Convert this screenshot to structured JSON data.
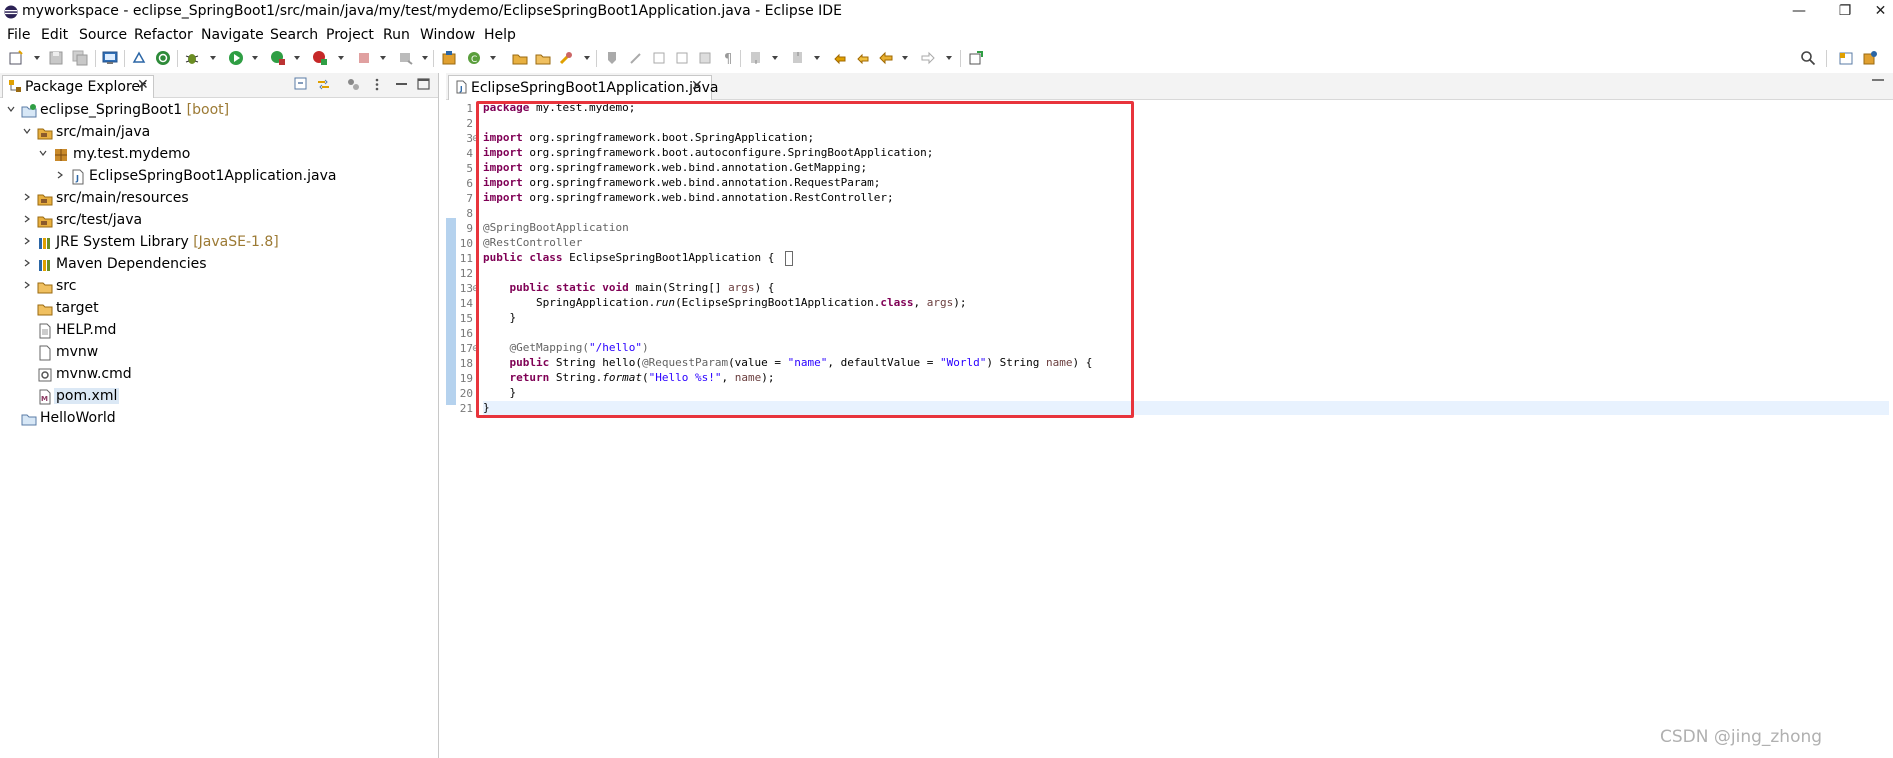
{
  "window": {
    "title": "myworkspace - eclipse_SpringBoot1/src/main/java/my/test/mydemo/EclipseSpringBoot1Application.java - Eclipse IDE",
    "minimize": "—",
    "restore": "❐",
    "close": "✕"
  },
  "menu": [
    "File",
    "Edit",
    "Source",
    "Refactor",
    "Navigate",
    "Search",
    "Project",
    "Run",
    "Window",
    "Help"
  ],
  "package_explorer": {
    "tab_label": "Package Explorer",
    "close": "✕",
    "tree": [
      {
        "label": "eclipse_SpringBoot1",
        "decor": " [boot]",
        "icon": "project-icon"
      },
      {
        "label": "src/main/java",
        "decor": "",
        "icon": "source-folder-icon"
      },
      {
        "label": "my.test.mydemo",
        "decor": "",
        "icon": "package-icon"
      },
      {
        "label": "EclipseSpringBoot1Application.java",
        "decor": "",
        "icon": "java-file-icon"
      },
      {
        "label": "src/main/resources",
        "decor": "",
        "icon": "source-folder-icon"
      },
      {
        "label": "src/test/java",
        "decor": "",
        "icon": "source-folder-icon"
      },
      {
        "label": "JRE System Library",
        "decor": " [JavaSE-1.8]",
        "icon": "library-icon"
      },
      {
        "label": "Maven Dependencies",
        "decor": "",
        "icon": "library-icon"
      },
      {
        "label": "src",
        "decor": "",
        "icon": "folder-icon"
      },
      {
        "label": "target",
        "decor": "",
        "icon": "folder-icon"
      },
      {
        "label": "HELP.md",
        "decor": "",
        "icon": "text-file-icon"
      },
      {
        "label": "mvnw",
        "decor": "",
        "icon": "text-file-icon"
      },
      {
        "label": "mvnw.cmd",
        "decor": "",
        "icon": "cmd-file-icon"
      },
      {
        "label": "pom.xml",
        "decor": "",
        "icon": "xml-file-icon"
      },
      {
        "label": "HelloWorld",
        "decor": "",
        "icon": "project-icon"
      }
    ]
  },
  "editor": {
    "tab_label": "EclipseSpringBoot1Application.java",
    "close": "✕",
    "line_numbers": [
      "1",
      "2",
      "3",
      "4",
      "5",
      "6",
      "7",
      "8",
      "9",
      "10",
      "11",
      "12",
      "13",
      "14",
      "15",
      "16",
      "17",
      "18",
      "19",
      "20",
      "21"
    ],
    "fold_markers": [
      "⊖",
      "⊖",
      "⊖"
    ],
    "code": {
      "l1_kw": "package",
      "l1_rest": " my.test.mydemo;",
      "import_kw": "import",
      "l3_rest": " org.springframework.boot.SpringApplication;",
      "l4_rest": " org.springframework.boot.autoconfigure.SpringBootApplication;",
      "l5_rest": " org.springframework.web.bind.annotation.GetMapping;",
      "l6_rest": " org.springframework.web.bind.annotation.RequestParam;",
      "l7_rest": " org.springframework.web.bind.annotation.RestController;",
      "l9": "@SpringBootApplication",
      "l10": "@RestController",
      "l11_kw": "public class",
      "l11_rest": " EclipseSpringBoot1Application ",
      "l11_brace": "{",
      "l13_indent": "    ",
      "l13_kw": "public static void",
      "l13_rest": " main(String[] ",
      "l13_var": "args",
      "l13_end": ") {",
      "l14_a": "        SpringApplication.",
      "l14_b": "run",
      "l14_c": "(EclipseSpringBoot1Application.",
      "l14_d": "class",
      "l14_e": ", ",
      "l14_f": "args",
      "l14_g": ");",
      "l15": "    }",
      "l17_a": "    @GetMapping(",
      "l17_b": "\"/hello\"",
      "l17_c": ")",
      "l18_kw": "public",
      "l18_a": " String hello(",
      "l18_b": "@RequestParam",
      "l18_c": "(value = ",
      "l18_d": "\"name\"",
      "l18_e": ", defaultValue = ",
      "l18_f": "\"World\"",
      "l18_g": ") String ",
      "l18_h": "name",
      "l18_i": ") {",
      "l19_kw": "return",
      "l19_a": " String.",
      "l19_b": "format",
      "l19_c": "(",
      "l19_d": "\"Hello %s!\"",
      "l19_e": ", ",
      "l19_f": "name",
      "l19_g": ");",
      "l20": "    }",
      "l21": "}"
    }
  },
  "watermark": "CSDN @jing_zhong",
  "colors": {
    "keyword": "#7f0055",
    "annotation": "#646464",
    "string": "#2a00ff",
    "highlight_box": "#e8343c",
    "current_line": "#e8f2fe"
  }
}
